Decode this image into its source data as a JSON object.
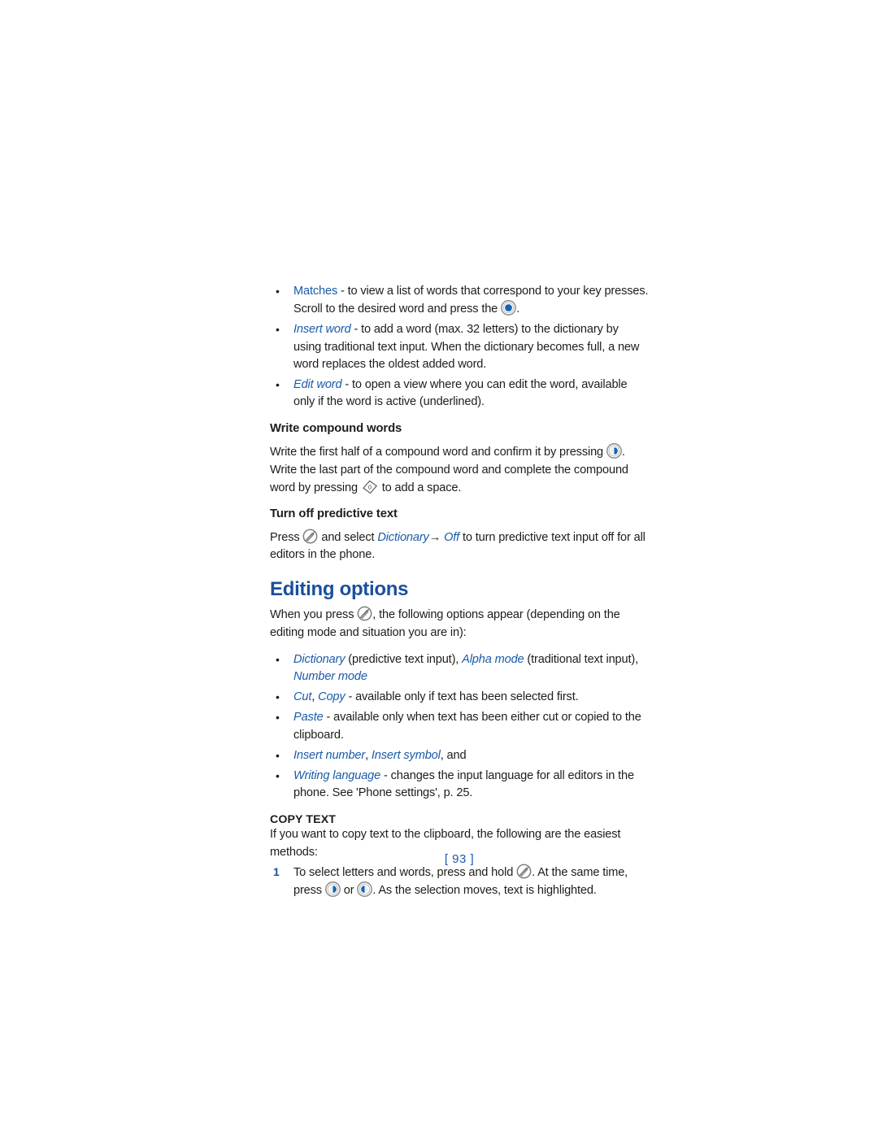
{
  "colors": {
    "heading_blue": "#1a4f9c",
    "term_blue": "#1a5bab",
    "body_black": "#1d1d1b",
    "icon_blue": "#1464b4",
    "icon_gray": "#6e6e6e"
  },
  "bullets_top": [
    {
      "term": "Matches",
      "term_style": "upright",
      "text_before_icon": " - to view a list of words that correspond to your key presses. Scroll to the desired word and press the ",
      "icon": "scroll-key-icon",
      "text_after_icon": "."
    },
    {
      "term": "Insert word",
      "term_style": "italic",
      "text_before_icon": " - to add a word (max. 32 letters) to the dictionary by using traditional text input. When the dictionary becomes full, a new word replaces the oldest added word.",
      "icon": null,
      "text_after_icon": ""
    },
    {
      "term": "Edit word",
      "term_style": "italic",
      "text_before_icon": " - to open a view where you can edit the word, available only if the word is active (underlined).",
      "icon": null,
      "text_after_icon": ""
    }
  ],
  "compound": {
    "heading": "Write compound words",
    "text_1": "Write the first half of a compound word and confirm it by pressing ",
    "icon_1": "scroll-right-key-icon",
    "text_2": ". Write the last part of the compound word and complete the compound word by pressing ",
    "icon_2": "zero-space-key-icon",
    "text_3": " to add a space."
  },
  "predictive_off": {
    "heading": "Turn off predictive text",
    "text_1": "Press ",
    "icon_1": "edit-menu-key-icon",
    "text_2": " and select ",
    "term_1": "Dictionary",
    "arrow": "→",
    "term_2": "Off",
    "text_3": " to turn predictive text input off for all editors in the phone."
  },
  "editing_options": {
    "title": "Editing options",
    "intro_before": "When you press ",
    "intro_icon": "edit-menu-key-icon",
    "intro_after": ", the following options appear (depending on the editing mode and situation you are in):",
    "items": [
      {
        "segments": [
          {
            "type": "term-italic",
            "text": "Dictionary"
          },
          {
            "type": "plain",
            "text": " (predictive text input), "
          },
          {
            "type": "term-italic",
            "text": "Alpha mode"
          },
          {
            "type": "plain",
            "text": " (traditional text input), "
          },
          {
            "type": "term-italic",
            "text": "Number mode"
          }
        ]
      },
      {
        "segments": [
          {
            "type": "term-italic",
            "text": "Cut"
          },
          {
            "type": "plain",
            "text": ", "
          },
          {
            "type": "term-italic",
            "text": "Copy"
          },
          {
            "type": "plain",
            "text": " - available only if text has been selected first."
          }
        ]
      },
      {
        "segments": [
          {
            "type": "term-italic",
            "text": "Paste"
          },
          {
            "type": "plain",
            "text": " - available only when text has been either cut or copied to the clipboard."
          }
        ]
      },
      {
        "segments": [
          {
            "type": "term-italic",
            "text": "Insert number"
          },
          {
            "type": "plain",
            "text": ", "
          },
          {
            "type": "term-italic",
            "text": "Insert symbol"
          },
          {
            "type": "plain",
            "text": ", and"
          }
        ]
      },
      {
        "segments": [
          {
            "type": "term-italic",
            "text": "Writing language"
          },
          {
            "type": "plain",
            "text": " - changes the input language for all editors in the phone. See 'Phone settings', p. 25."
          }
        ]
      }
    ]
  },
  "copy_text": {
    "heading": "COPY TEXT",
    "intro": "If you want to copy text to the clipboard, the following are the easiest methods:",
    "step_number": "1",
    "step_text_1": "To select letters and words, press and hold ",
    "step_icon_1": "edit-menu-key-icon",
    "step_text_2": ". At the same time, press ",
    "step_icon_2": "scroll-right-key-icon",
    "step_text_3": " or ",
    "step_icon_3": "scroll-left-key-icon",
    "step_text_4": ". As the selection moves, text is highlighted."
  },
  "footer": {
    "page_number": "[ 93 ]"
  }
}
